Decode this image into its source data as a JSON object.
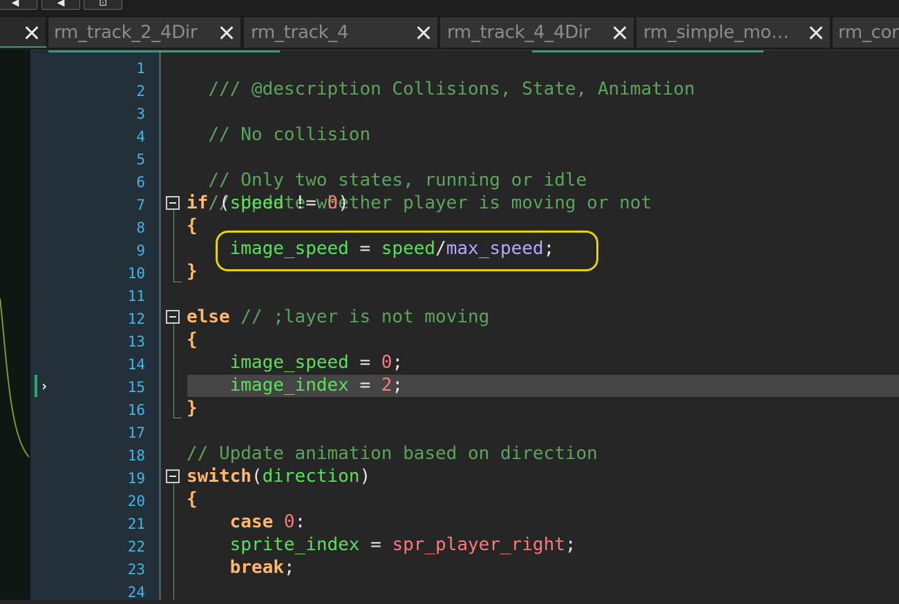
{
  "toolbar": {
    "buttons": [
      {
        "name": "back-button",
        "glyph": "◀"
      },
      {
        "name": "forward-button",
        "glyph": "◀"
      },
      {
        "name": "fit-button",
        "glyph": "⊡"
      }
    ]
  },
  "tabs": [
    {
      "label": "",
      "active": true
    },
    {
      "label": "rm_track_2_4Dir",
      "active": false
    },
    {
      "label": "rm_track_4",
      "active": false
    },
    {
      "label": "rm_track_4_4Dir",
      "active": false
    },
    {
      "label": "rm_simple_mo…",
      "active": false
    },
    {
      "label": "rm_cor",
      "active": false
    }
  ],
  "editor": {
    "current_line": 15,
    "line_numbers": [
      "1",
      "2",
      "3",
      "4",
      "5",
      "6",
      "7",
      "8",
      "9",
      "10",
      "11",
      "12",
      "13",
      "14",
      "15",
      "16",
      "17",
      "18",
      "19",
      "20",
      "21",
      "22",
      "23",
      "24"
    ],
    "code": {
      "l1_comment": "/// @description Collisions, State, Animation",
      "l3_comment": "// No collision",
      "l5_comment": "// Only two states, running or idle",
      "l6_comment": "// Update whether player is moving or not",
      "l7_kw": "if",
      "l7_open": " (",
      "l7_var": "speed",
      "l7_op": " != ",
      "l7_num": "0",
      "l7_close": ")",
      "brace_open": "{",
      "brace_close": "}",
      "l9_indent": "    ",
      "l9_var": "image_speed",
      "l9_op": " = ",
      "l9_var2": "speed",
      "l9_div": "/",
      "l9_fn": "max_speed",
      "semi": ";",
      "l12_kw": "else",
      "l12_comment": " // ;layer is not moving",
      "l14_var": "image_speed",
      "l14_op": " = ",
      "l14_num": "0",
      "l15_var": "image_index",
      "l15_op": " = ",
      "l15_num": "2",
      "l18_comment": "// Update animation based on direction",
      "l19_kw": "switch",
      "l19_open": "(",
      "l19_var": "direction",
      "l19_close": ")",
      "l21_kw": "case",
      "l21_num": " 0",
      "l21_colon": ":",
      "l22_var": "sprite_index",
      "l22_op": " = ",
      "l22_res": "spr_player_right",
      "l23_kw": "break"
    }
  },
  "colors": {
    "comment": "#5ba55b",
    "keyword": "#ffb86c",
    "variable": "#58e258",
    "number": "#ff7777",
    "function": "#b8a6ff",
    "line_number": "#3fb8e8",
    "highlight_ring": "#e8d400",
    "active_tab_accent": "#1fa97b"
  }
}
